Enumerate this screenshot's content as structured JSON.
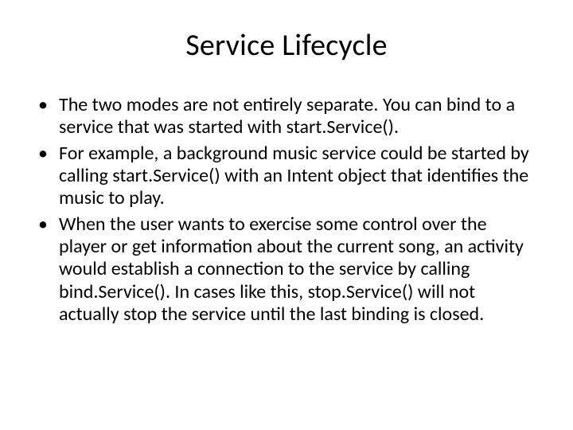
{
  "slide": {
    "title": "Service Lifecycle",
    "bullets": [
      "The two modes are not entirely separate. You can bind to a service that was started with start.Service().",
      "For example, a background music service could be started by calling start.Service() with an Intent object that identifies the music to play.",
      "When the user wants to exercise some control over the player or get information about the current song, an activity would establish a connection to the service by calling bind.Service(). In cases like this, stop.Service() will not actually stop the service until the last binding is closed."
    ]
  }
}
